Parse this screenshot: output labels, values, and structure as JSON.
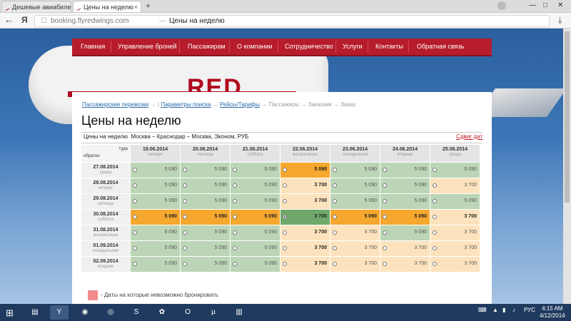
{
  "browser": {
    "tabs": [
      {
        "title": "Дешевые авиабилеты",
        "active": false
      },
      {
        "title": "Цены на неделю",
        "active": true
      }
    ],
    "new_tab": "+",
    "browser_logo": "Я",
    "url_domain": "booking.flyredwings.com",
    "url_separator": "—",
    "page_title": "Цены на неделю"
  },
  "plane_livery": "RED",
  "menu": {
    "items": [
      "Главная",
      "Управление броней",
      "Пассажирам",
      "О компании",
      "Сотрудничество",
      "Услуги",
      "Контакты",
      "Обратная связь"
    ]
  },
  "breadcrumb": {
    "items": [
      "Пассажирские перевозки",
      "Параметры поиска",
      "Рейсы/Тарифы",
      "Пассажиры",
      "Заказчик",
      "Заказ"
    ],
    "separators": [
      "→",
      "|",
      "→",
      "→",
      "→",
      "→"
    ]
  },
  "heading": "Цены на неделю",
  "subheading": {
    "label": "Цены на неделю",
    "route": "Москва – Краснодар – Москва, Эконом, РУБ",
    "shift_link": "Сдвиг дат"
  },
  "grid": {
    "there_label": "туда",
    "back_label": "обратно",
    "columns": [
      {
        "date": "19.06.2014",
        "weekday": "четверг"
      },
      {
        "date": "20.06.2014",
        "weekday": "пятница"
      },
      {
        "date": "21.06.2014",
        "weekday": "суббота"
      },
      {
        "date": "22.06.2014",
        "weekday": "воскресенье"
      },
      {
        "date": "23.06.2014",
        "weekday": "понедельник"
      },
      {
        "date": "24.06.2014",
        "weekday": "вторник"
      },
      {
        "date": "25.06.2014",
        "weekday": "среда"
      }
    ],
    "rows": [
      {
        "date": "27.08.2014",
        "weekday": "среда",
        "cells": [
          {
            "price": "5 090",
            "color": "green",
            "bold": false,
            "selected": false
          },
          {
            "price": "5 090",
            "color": "green",
            "bold": false,
            "selected": false
          },
          {
            "price": "5 090",
            "color": "green",
            "bold": false,
            "selected": false
          },
          {
            "price": "5 090",
            "color": "orange",
            "bold": true,
            "selected": false
          },
          {
            "price": "5 090",
            "color": "green",
            "bold": false,
            "selected": false
          },
          {
            "price": "5 090",
            "color": "green",
            "bold": false,
            "selected": false
          },
          {
            "price": "5 090",
            "color": "green",
            "bold": false,
            "selected": false
          }
        ]
      },
      {
        "date": "28.08.2014",
        "weekday": "четверг",
        "cells": [
          {
            "price": "5 090",
            "color": "green",
            "bold": false,
            "selected": false
          },
          {
            "price": "5 090",
            "color": "green",
            "bold": false,
            "selected": false
          },
          {
            "price": "5 090",
            "color": "green",
            "bold": false,
            "selected": false
          },
          {
            "price": "3 700",
            "color": "peach",
            "bold": true,
            "selected": false
          },
          {
            "price": "5 090",
            "color": "green",
            "bold": false,
            "selected": false
          },
          {
            "price": "5 090",
            "color": "green",
            "bold": false,
            "selected": false
          },
          {
            "price": "3 700",
            "color": "peach",
            "bold": false,
            "selected": false
          }
        ]
      },
      {
        "date": "29.08.2014",
        "weekday": "пятница",
        "cells": [
          {
            "price": "5 090",
            "color": "green",
            "bold": false,
            "selected": false
          },
          {
            "price": "5 090",
            "color": "green",
            "bold": false,
            "selected": false
          },
          {
            "price": "5 090",
            "color": "green",
            "bold": false,
            "selected": false
          },
          {
            "price": "3 700",
            "color": "peach",
            "bold": true,
            "selected": false
          },
          {
            "price": "5 090",
            "color": "green",
            "bold": false,
            "selected": false
          },
          {
            "price": "5 090",
            "color": "green",
            "bold": false,
            "selected": false
          },
          {
            "price": "5 090",
            "color": "green",
            "bold": false,
            "selected": false
          }
        ]
      },
      {
        "date": "30.08.2014",
        "weekday": "суббота",
        "cells": [
          {
            "price": "5 090",
            "color": "orange",
            "bold": true,
            "selected": false
          },
          {
            "price": "5 090",
            "color": "orange",
            "bold": true,
            "selected": false
          },
          {
            "price": "5 090",
            "color": "orange",
            "bold": true,
            "selected": false
          },
          {
            "price": "3 700",
            "color": "dkgreen",
            "bold": true,
            "selected": true
          },
          {
            "price": "5 090",
            "color": "orange",
            "bold": true,
            "selected": false
          },
          {
            "price": "5 090",
            "color": "orange",
            "bold": true,
            "selected": false
          },
          {
            "price": "3 700",
            "color": "peach",
            "bold": true,
            "selected": false
          }
        ]
      },
      {
        "date": "31.08.2014",
        "weekday": "воскресенье",
        "cells": [
          {
            "price": "5 090",
            "color": "green",
            "bold": false,
            "selected": false
          },
          {
            "price": "5 090",
            "color": "green",
            "bold": false,
            "selected": false
          },
          {
            "price": "5 090",
            "color": "green",
            "bold": false,
            "selected": false
          },
          {
            "price": "3 700",
            "color": "peach",
            "bold": true,
            "selected": false
          },
          {
            "price": "3 700",
            "color": "peach",
            "bold": false,
            "selected": false
          },
          {
            "price": "5 090",
            "color": "green",
            "bold": false,
            "selected": false
          },
          {
            "price": "3 700",
            "color": "peach",
            "bold": false,
            "selected": false
          }
        ]
      },
      {
        "date": "01.09.2014",
        "weekday": "понедельник",
        "cells": [
          {
            "price": "5 090",
            "color": "green",
            "bold": false,
            "selected": false
          },
          {
            "price": "5 090",
            "color": "green",
            "bold": false,
            "selected": false
          },
          {
            "price": "5 090",
            "color": "green",
            "bold": false,
            "selected": false
          },
          {
            "price": "3 700",
            "color": "peach",
            "bold": true,
            "selected": false
          },
          {
            "price": "3 700",
            "color": "peach",
            "bold": false,
            "selected": false
          },
          {
            "price": "3 700",
            "color": "peach",
            "bold": false,
            "selected": false
          },
          {
            "price": "3 700",
            "color": "peach",
            "bold": false,
            "selected": false
          }
        ]
      },
      {
        "date": "02.09.2014",
        "weekday": "вторник",
        "cells": [
          {
            "price": "5 090",
            "color": "green",
            "bold": false,
            "selected": false
          },
          {
            "price": "5 090",
            "color": "green",
            "bold": false,
            "selected": false
          },
          {
            "price": "5 090",
            "color": "green",
            "bold": false,
            "selected": false
          },
          {
            "price": "3 700",
            "color": "peach",
            "bold": true,
            "selected": false
          },
          {
            "price": "3 700",
            "color": "peach",
            "bold": false,
            "selected": false
          },
          {
            "price": "3 700",
            "color": "peach",
            "bold": false,
            "selected": false
          },
          {
            "price": "3 700",
            "color": "peach",
            "bold": false,
            "selected": false
          }
        ]
      }
    ]
  },
  "legend": {
    "text": "- Даты на которые невозможно бронировать",
    "color": "#f28c8c"
  },
  "colors": {
    "menu_red": "#b71c2c",
    "green": "#bcd5b6",
    "peach": "#fce3bd",
    "orange": "#f6a72d",
    "selected_green": "#6fa86a"
  },
  "taskbar": {
    "apps": [
      "file-explorer-icon",
      "yandex-browser-icon",
      "eye-app-icon",
      "chrome-icon",
      "skype-icon",
      "picasa-icon",
      "opera-icon",
      "utorrent-icon",
      "archive-icon"
    ],
    "language": "РУС",
    "time": "4:15 AM",
    "date": "4/12/2014"
  }
}
